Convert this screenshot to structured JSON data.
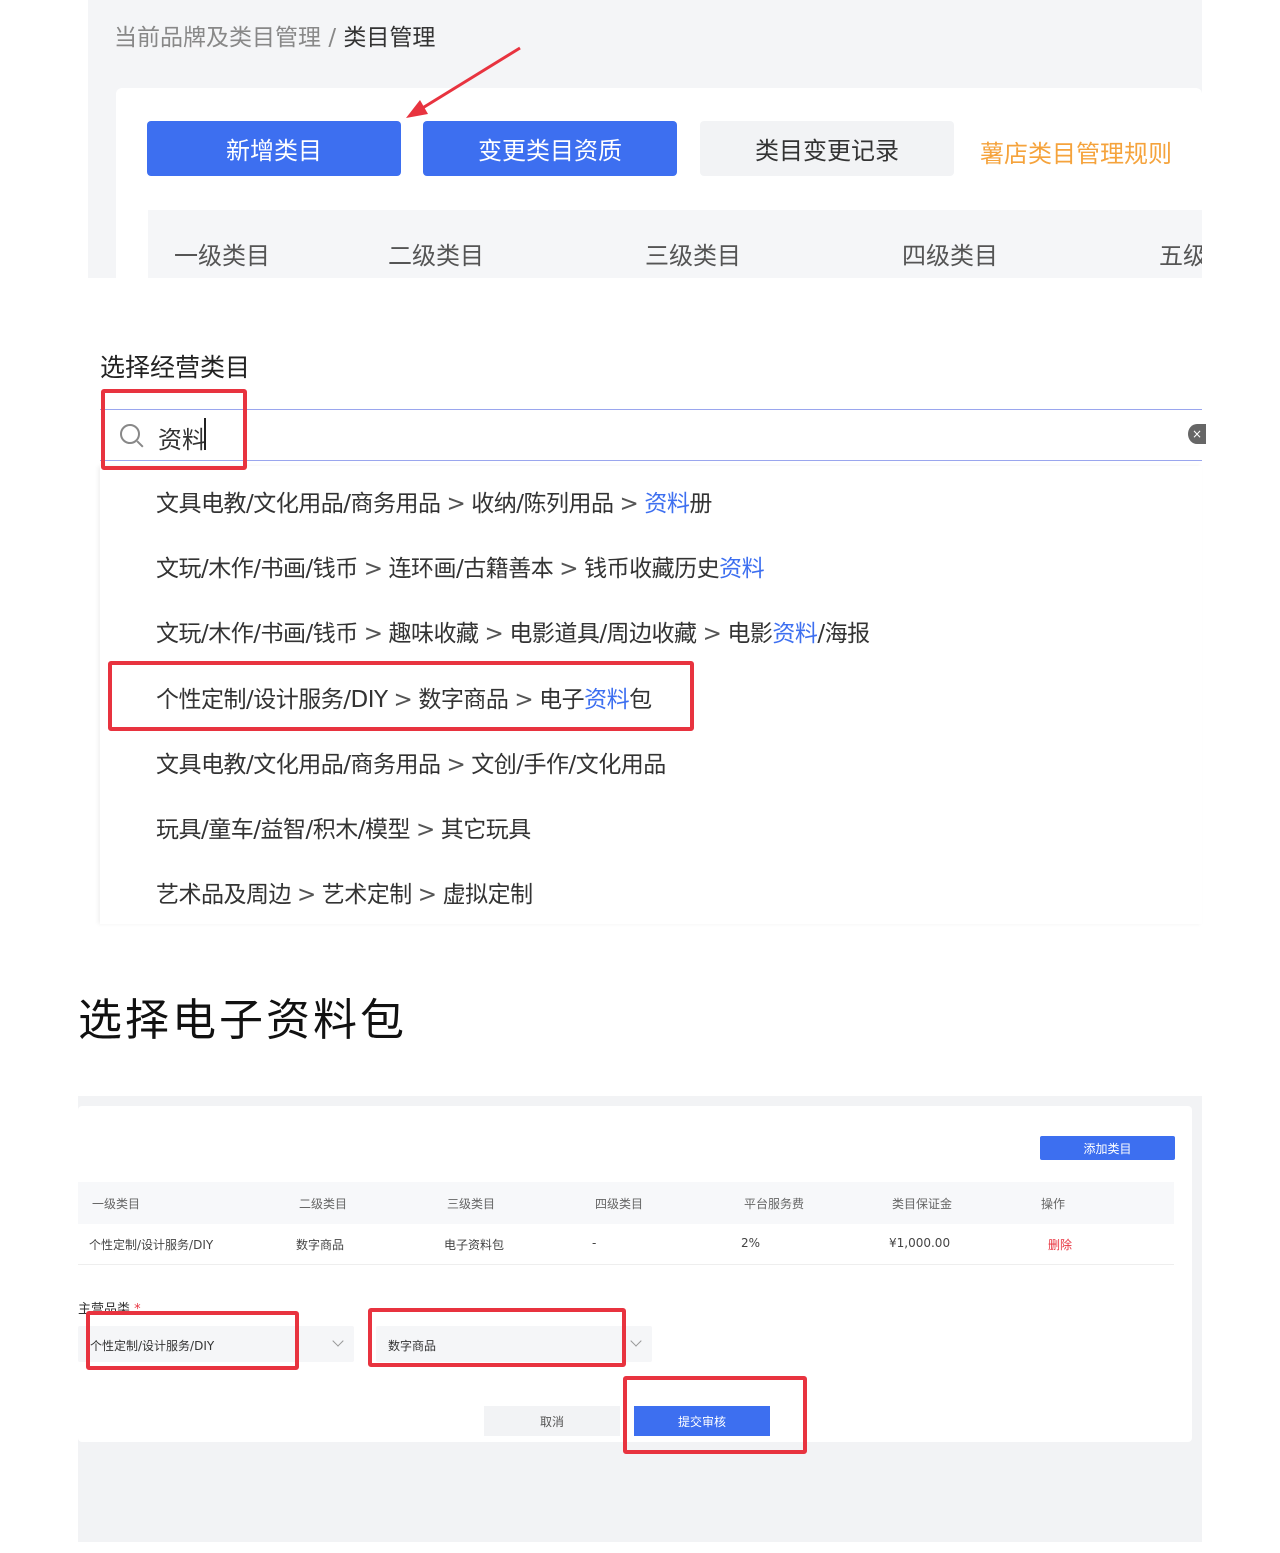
{
  "colors": {
    "primary": "#3d6ff0",
    "highlight_box": "#e8333f",
    "rule_link": "#f5a33c"
  },
  "breadcrumb": {
    "parent": "当前品牌及类目管理",
    "separator": "/",
    "current": "类目管理"
  },
  "toolbar": {
    "add_category": "新增类目",
    "change_qualification": "变更类目资质",
    "change_record": "类目变更记录",
    "rules_link": "薯店类目管理规则"
  },
  "levels": [
    "一级类目",
    "二级类目",
    "三级类目",
    "四级类目",
    "五级"
  ],
  "search_section": {
    "title": "选择经营类目",
    "query": "资料",
    "options": [
      {
        "parts": [
          "文具电教/文化用品/商务用品",
          "收纳/陈列用品"
        ],
        "last_hl": "资料",
        "last_rest": "册",
        "last_pre": ""
      },
      {
        "parts": [
          "文玩/木作/书画/钱币",
          "连环画/古籍善本"
        ],
        "last_pre": "钱币收藏历史",
        "last_hl": "资料",
        "last_rest": ""
      },
      {
        "parts": [
          "文玩/木作/书画/钱币",
          "趣味收藏",
          "电影道具/周边收藏"
        ],
        "last_pre": "电影",
        "last_hl": "资料",
        "last_rest": "/海报"
      },
      {
        "parts": [
          "个性定制/设计服务/DIY",
          "数字商品"
        ],
        "last_pre": "电子",
        "last_hl": "资料",
        "last_rest": "包"
      },
      {
        "parts": [
          "文具电教/文化用品/商务用品"
        ],
        "last_pre": "文创/手作/文化用品",
        "last_hl": "",
        "last_rest": ""
      },
      {
        "parts": [
          "玩具/童车/益智/积木/模型"
        ],
        "last_pre": "其它玩具",
        "last_hl": "",
        "last_rest": ""
      },
      {
        "parts": [
          "艺术品及周边",
          "艺术定制"
        ],
        "last_pre": "虚拟定制",
        "last_hl": "",
        "last_rest": ""
      }
    ],
    "separator": ">"
  },
  "caption": "选择电子资料包",
  "form": {
    "add_button": "添加类目",
    "headers": [
      "一级类目",
      "二级类目",
      "三级类目",
      "四级类目",
      "平台服务费",
      "类目保证金",
      "操作"
    ],
    "row": [
      "个性定制/设计服务/DIY",
      "数字商品",
      "电子资料包",
      "-",
      "2%",
      "¥1,000.00",
      "删除"
    ],
    "main_category_label": "主营品类",
    "required_mark": "*",
    "select1": "个性定制/设计服务/DIY",
    "select2": "数字商品",
    "cancel": "取消",
    "submit": "提交审核"
  }
}
